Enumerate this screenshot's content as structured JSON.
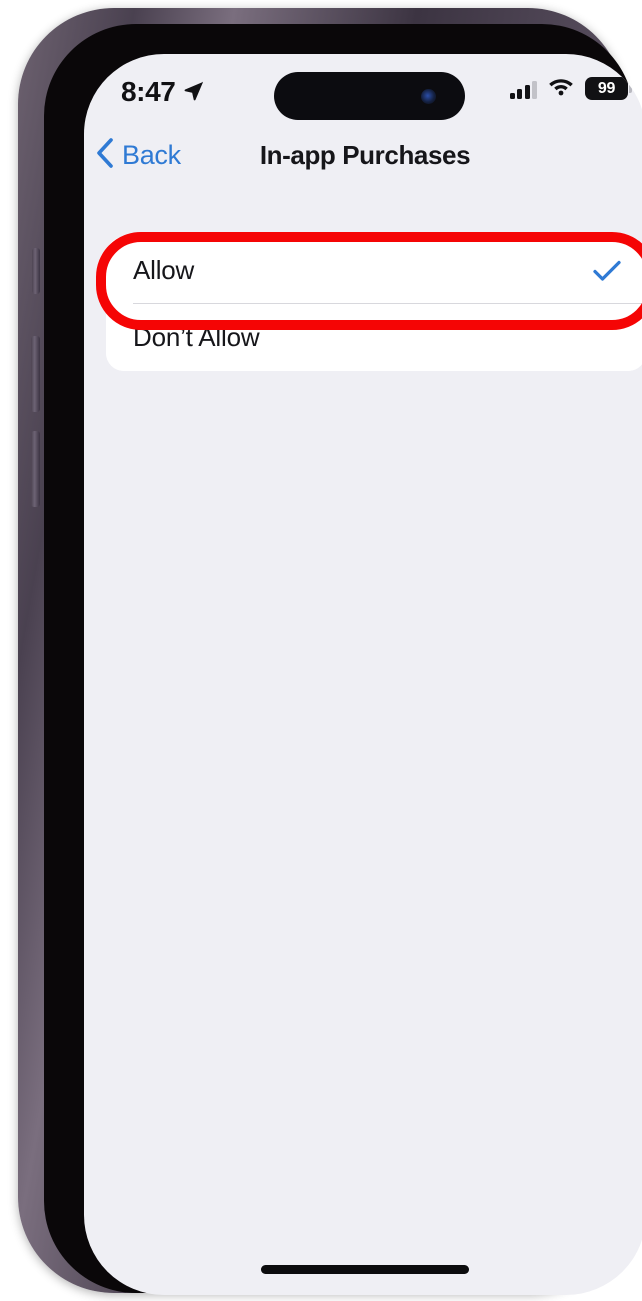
{
  "device": {
    "name": "iphone-14-pro",
    "frame_color": "#564c5c",
    "screen_background": "#efeff4"
  },
  "status_bar": {
    "time": "8:47",
    "location_icon": "location-arrow-icon",
    "signal_icon": "cellular-signal-icon",
    "signal_bars_filled": 3,
    "signal_bars_total": 4,
    "wifi_icon": "wifi-icon",
    "battery_icon": "battery-icon",
    "battery_level": "99"
  },
  "nav_bar": {
    "back_icon": "chevron-left-icon",
    "back_label": "Back",
    "title": "In-app Purchases",
    "tint_color": "#2f7ad4"
  },
  "options": {
    "items": [
      {
        "label": "Allow",
        "selected": true,
        "check_icon": "checkmark-icon"
      },
      {
        "label": "Don’t Allow",
        "selected": false,
        "check_icon": ""
      }
    ]
  },
  "annotation": {
    "shape": "rounded-rectangle-highlight",
    "color": "#f50505",
    "target": "Allow"
  },
  "home_indicator": {
    "label": "home-indicator"
  }
}
